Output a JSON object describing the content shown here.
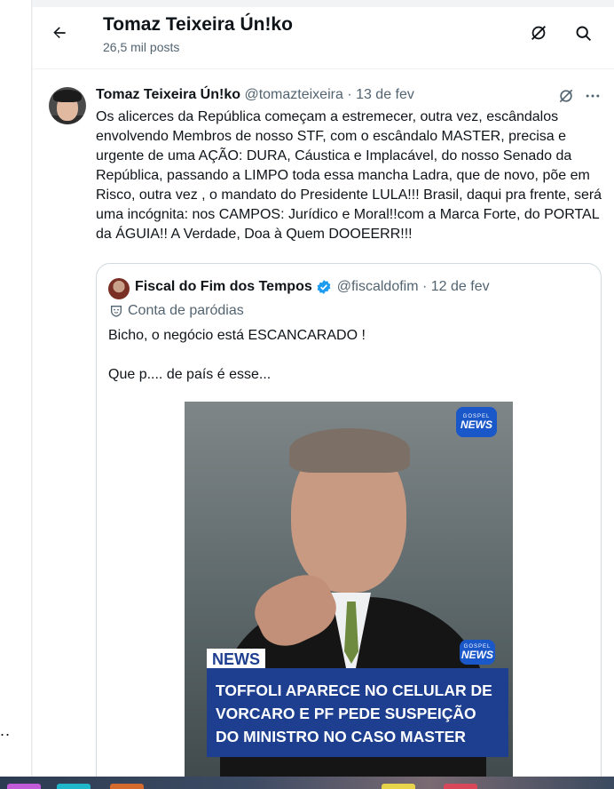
{
  "header": {
    "title": "Tomaz Teixeira Ún!ko",
    "post_count": "26,5 mil posts",
    "back_icon": "arrow-left-icon",
    "grok_icon": "grok-icon",
    "search_icon": "search-icon"
  },
  "post": {
    "author_name": "Tomaz Teixeira Ún!ko",
    "meta": "@tomazteixeira · 13 de fev",
    "text": "Os alicerces da República começam a estremecer, outra vez, escândalos envolvendo Membros de nosso STF, com o escândalo MASTER, precisa e urgente de uma AÇÃO: DURA, Cáustica e Implacável, do nosso Senado  da República, passando a LIMPO toda essa mancha Ladra, que de novo, põe em Risco, outra vez , o mandato do Presidente LULA!!! Brasil, daqui pra frente, será uma incógnita: nos CAMPOS: Jurídico e Moral!!com a Marca Forte, do PORTAL da ÁGUIA!! A Verdade, Doa à Quem DOOEERR!!!",
    "more_icon": "more-icon"
  },
  "quote": {
    "author_name": "Fiscal do Fim dos Tempos",
    "meta": "@fiscaldofim · 12 de fev",
    "parody_label": "Conta de paródias",
    "line1": "Bicho, o negócio está ESCANCARADO !",
    "line2": "Que p.... de país é esse...",
    "media": {
      "badge_small": "GOSPEL",
      "badge_big": "NEWS",
      "news_tag": "NEWS",
      "headline_1": "TOFFOLI APARECE NO CELULAR DE",
      "headline_2": "VORCARO E PF  PEDE SUSPEIÇÃO",
      "headline_3": "DO MINISTRO NO CASO MASTER"
    }
  },
  "left_rail": {
    "more": ".."
  },
  "colors": {
    "accent": "#1d9bf0",
    "text": "#0f1419",
    "muted": "#536471",
    "news_blue": "#1e3f8f"
  }
}
